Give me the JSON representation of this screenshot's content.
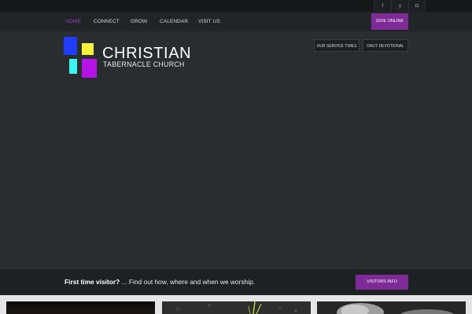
{
  "social": [
    {
      "icon": "facebook-icon",
      "glyph": "f"
    },
    {
      "icon": "twitter-icon",
      "glyph": "y"
    },
    {
      "icon": "instagram-icon",
      "glyph": "◘"
    }
  ],
  "nav": {
    "items": [
      {
        "label": "HOME",
        "active": true
      },
      {
        "label": "CONNECT",
        "active": false
      },
      {
        "label": "GROW",
        "active": false
      },
      {
        "label": "CALENDAR",
        "active": false
      },
      {
        "label": "VISIT US",
        "active": false
      }
    ],
    "give_label": "GIVE ONLINE"
  },
  "logo": {
    "title": "CHRISTIAN",
    "subtitle": "TABERNACLE CHURCH"
  },
  "header_buttons": {
    "service_times": "OUR SERVICE TIMES",
    "devotional": "DAILY DEVOTIONAL"
  },
  "visitor": {
    "lead": "First time visitor?",
    "text": " ... Find out how, where and when we worship.",
    "button": "VISITORS INFO"
  },
  "colors": {
    "accent": "#7e2b98",
    "active_nav": "#9b3fbf",
    "logo_blue": "#1f3cff",
    "logo_yellow": "#f7f23a",
    "logo_cyan": "#3ef2f2",
    "logo_purple": "#b614e6"
  }
}
